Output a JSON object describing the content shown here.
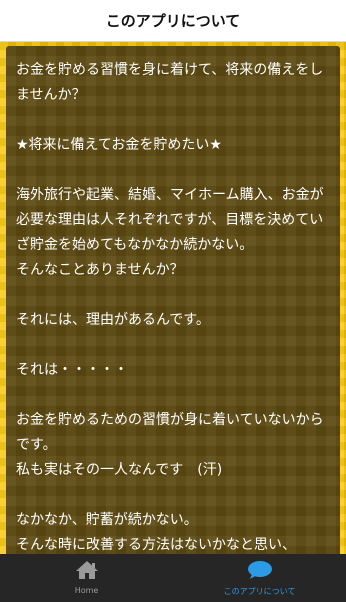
{
  "header": {
    "title": "このアプリについて"
  },
  "content": {
    "paragraphs": [
      "お金を貯める習慣を身に着けて、将来の備えをしませんか？",
      "★将来に備えてお金を貯めたい★",
      "海外旅行や起業、結婚、マイホーム購入、お金が必要な理由は人それぞれですが、目標を決めていざ貯金を始めてもなかなか続かない。\nそんなことありませんか？",
      "それには、理由があるんです。",
      "それは・・・・・",
      "お金を貯めるための習慣が身に着いていないからです。\n私も実はその一人なんです　(汗)",
      "なかなか、貯蓄が続かない。\nそんな時に改善する方法はないかなと思い、"
    ]
  },
  "tabbar": {
    "tabs": [
      {
        "label": "Home",
        "icon": "home-icon",
        "active": false,
        "color": "#9a9a9a"
      },
      {
        "label": "このアプリについて",
        "icon": "speech-bubble-icon",
        "active": true,
        "color": "#2c9be6"
      }
    ]
  }
}
